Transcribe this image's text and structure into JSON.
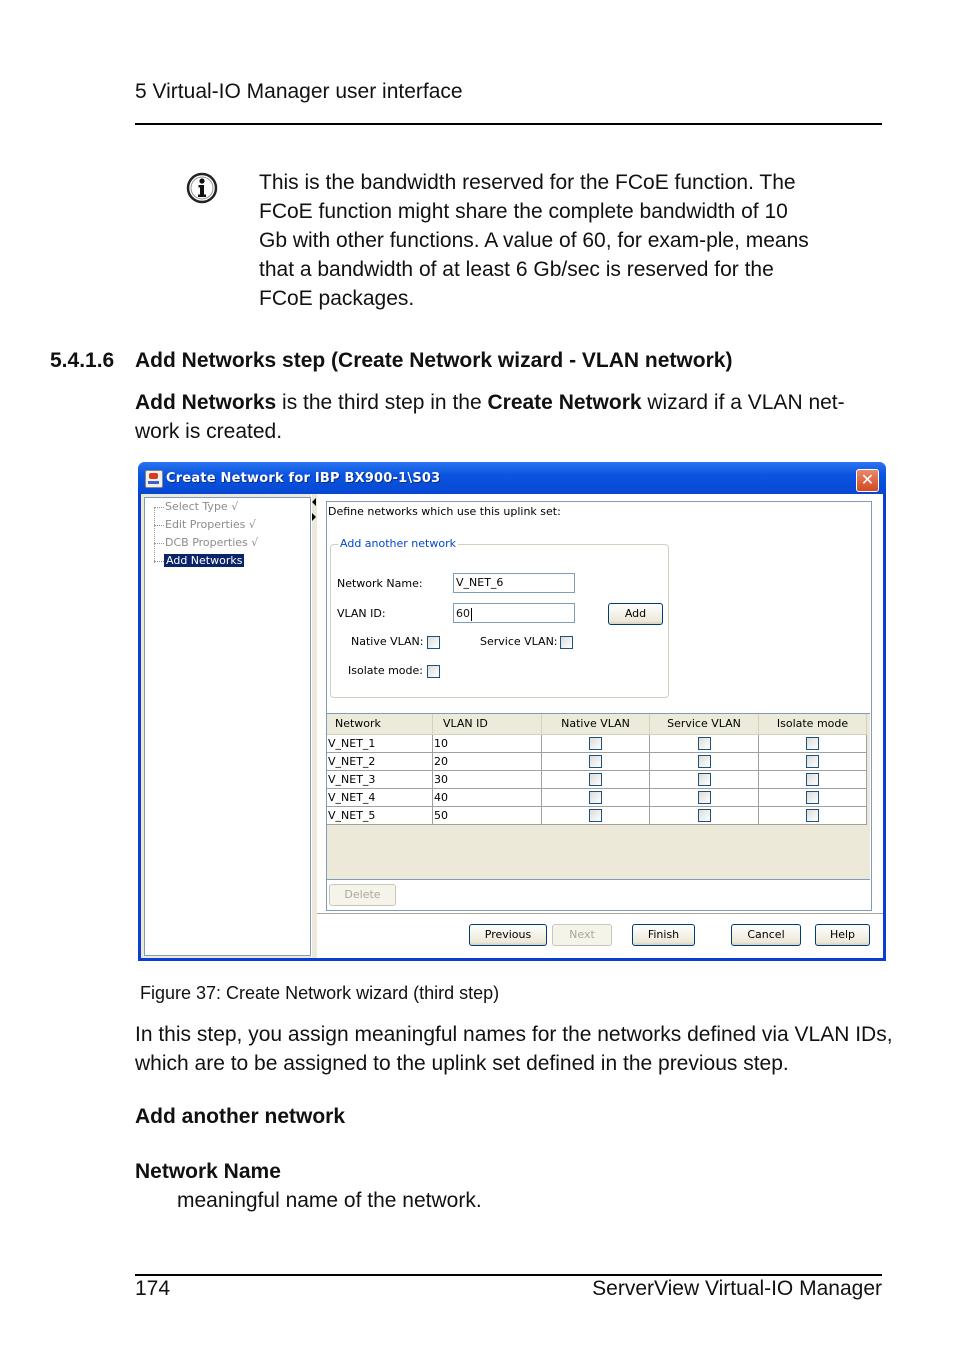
{
  "page": {
    "running_head": "5 Virtual-IO Manager user interface",
    "note": {
      "icon": "info-icon",
      "text": "This is the bandwidth reserved for the FCoE function. The FCoE function might share the complete bandwidth of 10 Gb with other functions. A value of 60, for exam-ple, means that a bandwidth of at least 6 Gb/sec is reserved for the FCoE packages."
    },
    "section": {
      "number": "5.4.1.6",
      "title": "Add Networks step (Create Network wizard - VLAN network)"
    },
    "intro": {
      "part1_bold": "Add Networks",
      "part2": " is the third step in the ",
      "part3_bold": "Create Network",
      "part4": " wizard if a VLAN net-work is created."
    },
    "caption": "Figure 37: Create Network wizard (third step)",
    "paragraph": "In this step, you assign meaningful names for the networks defined via VLAN IDs, which are to be assigned to the uplink set defined in the previous step.",
    "subheading_1": "Add another network",
    "subheading_2": "Network Name",
    "description": "meaningful name of the network.",
    "footer": {
      "page_number": "174",
      "title": "ServerView Virtual-IO Manager"
    }
  },
  "dialog": {
    "title": "Create Network for IBP BX900-1\\S03",
    "close_icon": "close-icon",
    "steps": [
      {
        "label": "Select Type √",
        "selected": false
      },
      {
        "label": "Edit Properties √",
        "selected": false
      },
      {
        "label": "DCB Properties √",
        "selected": false
      },
      {
        "label": "Add Networks",
        "selected": true
      }
    ],
    "panel_label": "Define networks which use this uplink set:",
    "group": {
      "title": "Add another network",
      "network_name_label": "Network Name:",
      "network_name_value": "V_NET_6",
      "vlan_id_label": "VLAN ID:",
      "vlan_id_value": "60",
      "add_button": "Add",
      "native_vlan_label": "Native VLAN:",
      "native_vlan_checked": false,
      "service_vlan_label": "Service VLAN:",
      "service_vlan_checked": false,
      "isolate_mode_label": "Isolate mode:",
      "isolate_mode_checked": false
    },
    "table": {
      "columns": [
        "Network",
        "VLAN ID",
        "Native VLAN",
        "Service VLAN",
        "Isolate mode"
      ],
      "rows": [
        {
          "network": "V_NET_1",
          "vlan_id": "10",
          "native": false,
          "service": false,
          "isolate": false
        },
        {
          "network": "V_NET_2",
          "vlan_id": "20",
          "native": false,
          "service": false,
          "isolate": false
        },
        {
          "network": "V_NET_3",
          "vlan_id": "30",
          "native": false,
          "service": false,
          "isolate": false
        },
        {
          "network": "V_NET_4",
          "vlan_id": "40",
          "native": false,
          "service": false,
          "isolate": false
        },
        {
          "network": "V_NET_5",
          "vlan_id": "50",
          "native": false,
          "service": false,
          "isolate": false
        }
      ]
    },
    "delete_button": "Delete",
    "buttons": {
      "previous": "Previous",
      "next": "Next",
      "finish": "Finish",
      "cancel": "Cancel",
      "help": "Help"
    }
  }
}
